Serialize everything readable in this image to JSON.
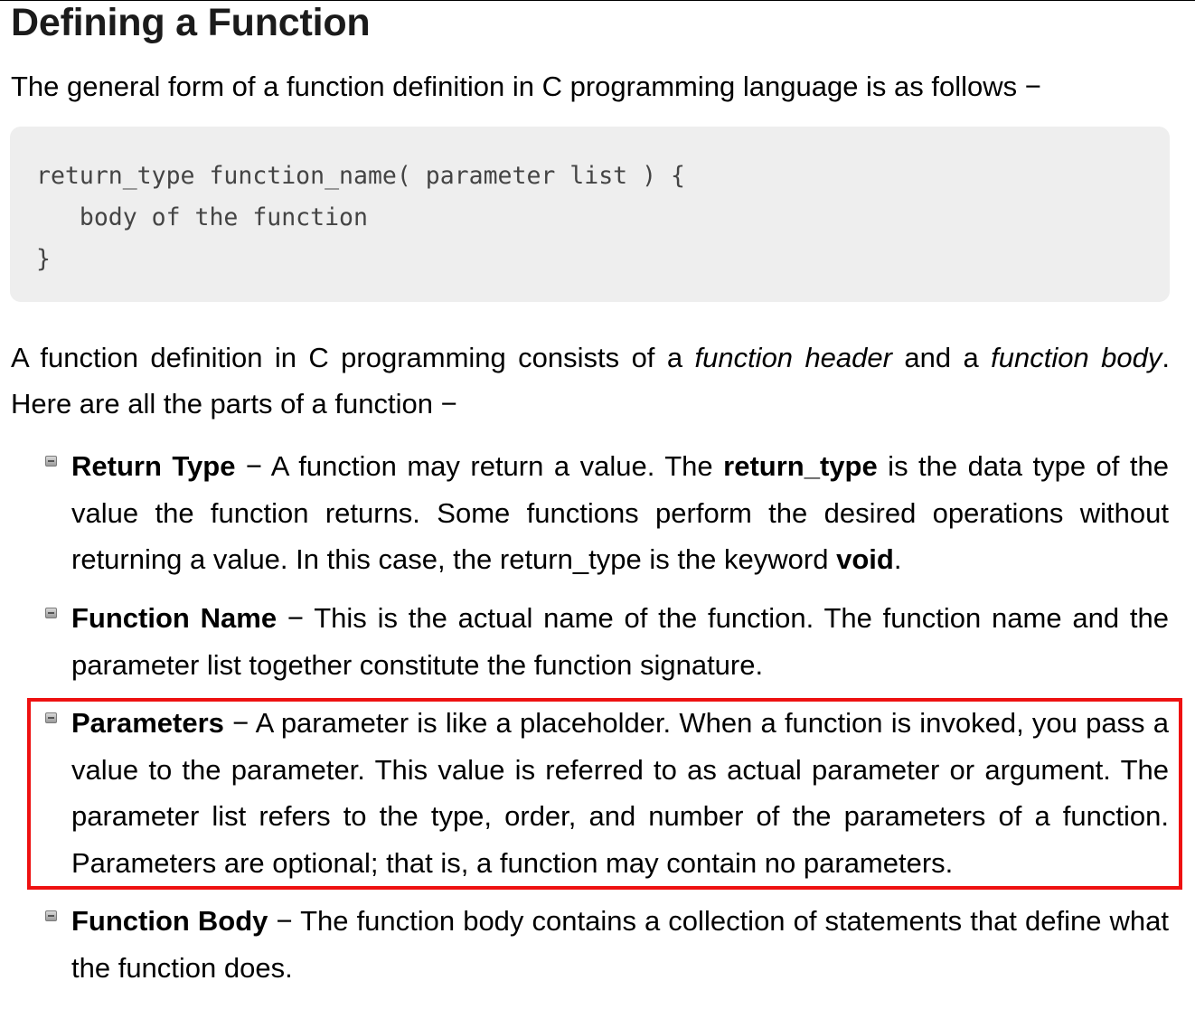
{
  "title": "Defining a Function",
  "intro": "The general form of a function definition in C programming language is as follows −",
  "code": {
    "lines": [
      "return_type function_name( parameter list ) {",
      "   body of the function",
      "}"
    ]
  },
  "definition": {
    "part1": "A function definition in C programming consists of a ",
    "em1": "function header",
    "part2": " and a ",
    "em2": "function body",
    "part3": ". Here are all the parts of a function −"
  },
  "items": [
    {
      "term": "Return Type",
      "text1": " − A function may return a value. The ",
      "bold2": "return_type",
      "text2": " is the data type of the value the function returns. Some functions perform the desired operations without returning a value. In this case, the return_type is the keyword ",
      "bold3": "void",
      "text3": "."
    },
    {
      "term": "Function Name",
      "text1": " − This is the actual name of the function. The function name and the parameter list together constitute the function signature."
    },
    {
      "term": "Parameters",
      "text1": " − A parameter is like a placeholder. When a function is invoked, you pass a value to the parameter. This value is referred to as actual parameter or argument. The parameter list refers to the type, order, and number of the parameters of a function. Parameters are optional; that is, a function may contain no parameters."
    },
    {
      "term": "Function Body",
      "text1": " − The function body contains a collection of statements that define what the function does."
    }
  ],
  "highlight_color": "#ee1111",
  "code_background": "#eeeeee"
}
